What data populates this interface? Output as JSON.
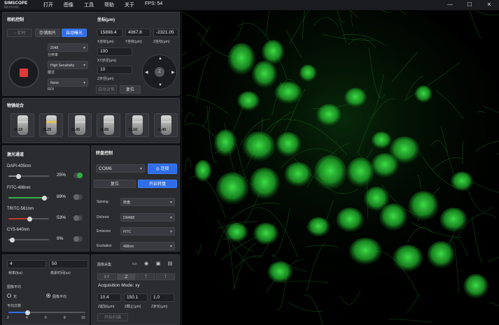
{
  "app": {
    "logo_text": "SIMSCOPE",
    "logo_sub": "精密光学显微镜",
    "menu": [
      "打开",
      "图像",
      "工具",
      "帮助",
      "关于"
    ],
    "fps_label": "FPS: 54",
    "window_controls": [
      "—",
      "☐",
      "✕"
    ]
  },
  "camera": {
    "title": "相机控制",
    "btn_live": "○ 实时",
    "btn_save": "存储图片",
    "btn_autoexp": "自动曝光",
    "resolution_value": "2048",
    "resolution_label": "分辨率",
    "mode_value": "High Sensitivity",
    "mode_label": "模式",
    "roi_value": "None",
    "roi_label": "ROI"
  },
  "stage": {
    "title": "坐标(μm)",
    "x_value": "15898.4",
    "y_value": "4067.8",
    "z_value": "-2321.05",
    "x_label": "X坐标(μm)",
    "y_label": "Y坐标(μm)",
    "z_label": "Z坐标(μm)",
    "xy_step_value": "100",
    "xy_step_label": "XY步径(μm)",
    "z_step_value": "10",
    "z_step_label": "Z步径(μm)",
    "btn_auto_focus": "自动对焦",
    "btn_reset": "复位",
    "joy_center": "Z"
  },
  "objectives": {
    "title": "物镜组合",
    "items": [
      {
        "mag": "4X",
        "na": "/0.13"
      },
      {
        "mag": "10X",
        "na": "/0.25"
      },
      {
        "mag": "20X",
        "na": "/0.45"
      },
      {
        "mag": "40X",
        "na": "/0.65"
      },
      {
        "mag": "60X",
        "na": "/1.10"
      },
      {
        "mag": "100X",
        "na": "/1.40"
      }
    ]
  },
  "lasers": {
    "title": "激光通道",
    "channels": [
      {
        "name": "DAPI-405nm",
        "value": "25%",
        "level": 0.25,
        "color": "#8a8a8a",
        "on": true
      },
      {
        "name": "FITC-488nm",
        "value": "89%",
        "level": 0.89,
        "color": "#34b34a",
        "on": false
      },
      {
        "name": "TRITC-561nm",
        "value": "53%",
        "level": 0.53,
        "color": "#c0392b",
        "on": false
      },
      {
        "name": "CY5-640nm",
        "value": "9%",
        "level": 0.09,
        "color": "#8a8a8a",
        "on": false
      }
    ]
  },
  "turret": {
    "title": "转盘控制",
    "port_value": "COM6",
    "btn_connect": "◎ 连接",
    "btn_reset": "复位",
    "btn_start_disk": "开启转盘",
    "rows": [
      {
        "label": "Spining",
        "value": "转盘"
      },
      {
        "label": "Dichroic",
        "value": "DM488"
      },
      {
        "label": "Emission",
        "value": "FITC"
      },
      {
        "label": "Excitation",
        "value": "488nm"
      }
    ]
  },
  "acquisition": {
    "frame_rate_value": "4",
    "frame_rate_label": "帧率(fps)",
    "pixel_time_value": "50",
    "pixel_time_label": "像素时间(us)",
    "avg_title": "图像平均",
    "opt_none": "无",
    "opt_avg": "图像平均",
    "avg_count_label": "平均次数",
    "slider_ticks": [
      "2",
      "4",
      "6",
      "8",
      "10"
    ],
    "avg_level": 0.25
  },
  "capture": {
    "title": "图像采集",
    "seg": [
      "XY",
      "Z",
      "T",
      "T"
    ],
    "mode_text": "Acquisition Mode: xy",
    "z_start_value": "10.4",
    "z_end_value": "150.1",
    "z_step_value": "1.0",
    "z_start_label": "Z起始(μm)",
    "z_end_label": "Z截止(μm)",
    "z_step_label": "Z步长(μm)",
    "btn_start_scan": "开始扫描"
  },
  "viewer": {
    "bg_color": "#000000",
    "fluor_color": "#2ecf3a"
  }
}
